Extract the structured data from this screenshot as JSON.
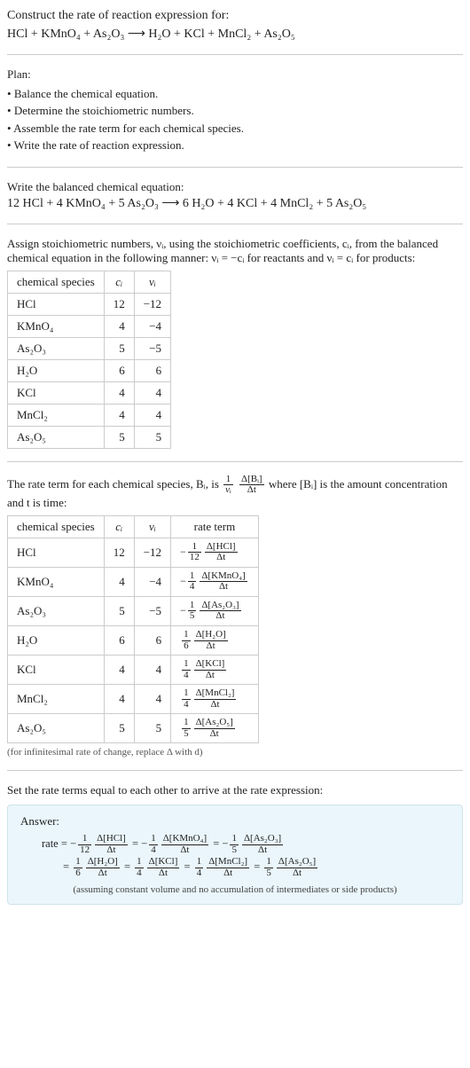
{
  "header": {
    "title": "Construct the rate of reaction expression for:",
    "equation": "HCl + KMnO₄ + As₂O₃ ⟶ H₂O + KCl + MnCl₂ + As₂O₅"
  },
  "plan": {
    "label": "Plan:",
    "items": [
      "Balance the chemical equation.",
      "Determine the stoichiometric numbers.",
      "Assemble the rate term for each chemical species.",
      "Write the rate of reaction expression."
    ]
  },
  "balanced": {
    "label": "Write the balanced chemical equation:",
    "equation": "12 HCl + 4 KMnO₄ + 5 As₂O₃ ⟶ 6 H₂O + 4 KCl + 4 MnCl₂ + 5 As₂O₅"
  },
  "stoich": {
    "intro": "Assign stoichiometric numbers, νᵢ, using the stoichiometric coefficients, cᵢ, from the balanced chemical equation in the following manner: νᵢ = −cᵢ for reactants and νᵢ = cᵢ for products:",
    "headers": {
      "species": "chemical species",
      "c": "cᵢ",
      "nu": "νᵢ"
    },
    "rows": [
      {
        "species": "HCl",
        "c": "12",
        "nu": "−12"
      },
      {
        "species": "KMnO₄",
        "c": "4",
        "nu": "−4"
      },
      {
        "species": "As₂O₃",
        "c": "5",
        "nu": "−5"
      },
      {
        "species": "H₂O",
        "c": "6",
        "nu": "6"
      },
      {
        "species": "KCl",
        "c": "4",
        "nu": "4"
      },
      {
        "species": "MnCl₂",
        "c": "4",
        "nu": "4"
      },
      {
        "species": "As₂O₅",
        "c": "5",
        "nu": "5"
      }
    ]
  },
  "rateterm": {
    "intro_pre": "The rate term for each chemical species, Bᵢ, is ",
    "intro_post": " where [Bᵢ] is the amount concentration and t is time:",
    "frac_outer_num": "1",
    "frac_outer_den": "νᵢ",
    "frac_inner_num": "Δ[Bᵢ]",
    "frac_inner_den": "Δt",
    "headers": {
      "species": "chemical species",
      "c": "cᵢ",
      "nu": "νᵢ",
      "rate": "rate term"
    },
    "rows": [
      {
        "species": "HCl",
        "c": "12",
        "nu": "−12",
        "sign": "−",
        "coef_num": "1",
        "coef_den": "12",
        "d_num": "Δ[HCl]",
        "d_den": "Δt"
      },
      {
        "species": "KMnO₄",
        "c": "4",
        "nu": "−4",
        "sign": "−",
        "coef_num": "1",
        "coef_den": "4",
        "d_num": "Δ[KMnO₄]",
        "d_den": "Δt"
      },
      {
        "species": "As₂O₃",
        "c": "5",
        "nu": "−5",
        "sign": "−",
        "coef_num": "1",
        "coef_den": "5",
        "d_num": "Δ[As₂O₃]",
        "d_den": "Δt"
      },
      {
        "species": "H₂O",
        "c": "6",
        "nu": "6",
        "sign": "",
        "coef_num": "1",
        "coef_den": "6",
        "d_num": "Δ[H₂O]",
        "d_den": "Δt"
      },
      {
        "species": "KCl",
        "c": "4",
        "nu": "4",
        "sign": "",
        "coef_num": "1",
        "coef_den": "4",
        "d_num": "Δ[KCl]",
        "d_den": "Δt"
      },
      {
        "species": "MnCl₂",
        "c": "4",
        "nu": "4",
        "sign": "",
        "coef_num": "1",
        "coef_den": "4",
        "d_num": "Δ[MnCl₂]",
        "d_den": "Δt"
      },
      {
        "species": "As₂O₅",
        "c": "5",
        "nu": "5",
        "sign": "",
        "coef_num": "1",
        "coef_den": "5",
        "d_num": "Δ[As₂O₅]",
        "d_den": "Δt"
      }
    ],
    "note": "(for infinitesimal rate of change, replace Δ with d)"
  },
  "final": {
    "intro": "Set the rate terms equal to each other to arrive at the rate expression:",
    "answer_label": "Answer:",
    "rate_label": "rate",
    "line1": [
      {
        "sign": "−",
        "cn": "1",
        "cd": "12",
        "dn": "Δ[HCl]",
        "dd": "Δt"
      },
      {
        "sign": "−",
        "cn": "1",
        "cd": "4",
        "dn": "Δ[KMnO₄]",
        "dd": "Δt"
      },
      {
        "sign": "−",
        "cn": "1",
        "cd": "5",
        "dn": "Δ[As₂O₃]",
        "dd": "Δt"
      }
    ],
    "line2": [
      {
        "sign": "",
        "cn": "1",
        "cd": "6",
        "dn": "Δ[H₂O]",
        "dd": "Δt"
      },
      {
        "sign": "",
        "cn": "1",
        "cd": "4",
        "dn": "Δ[KCl]",
        "dd": "Δt"
      },
      {
        "sign": "",
        "cn": "1",
        "cd": "4",
        "dn": "Δ[MnCl₂]",
        "dd": "Δt"
      },
      {
        "sign": "",
        "cn": "1",
        "cd": "5",
        "dn": "Δ[As₂O₅]",
        "dd": "Δt"
      }
    ],
    "assume": "(assuming constant volume and no accumulation of intermediates or side products)"
  }
}
